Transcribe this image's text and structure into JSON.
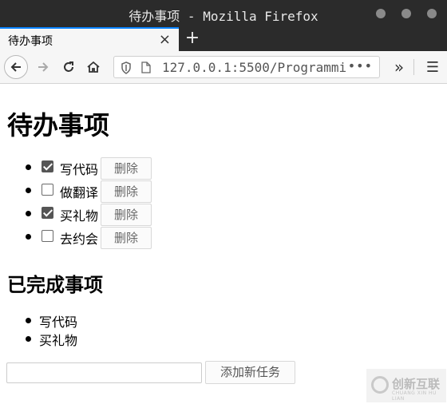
{
  "window": {
    "title": "待办事项 - Mozilla Firefox"
  },
  "tab": {
    "label": "待办事项",
    "close": "×",
    "new_tab": "+"
  },
  "nav": {
    "url": "127.0.0.1:5500/Programmi",
    "more": "•••",
    "overflow": "»",
    "menu": "☰"
  },
  "page": {
    "title": "待办事项",
    "todos": [
      {
        "text": "写代码",
        "checked": true,
        "delete_label": "删除"
      },
      {
        "text": "做翻译",
        "checked": false,
        "delete_label": "删除"
      },
      {
        "text": "买礼物",
        "checked": true,
        "delete_label": "删除"
      },
      {
        "text": "去约会",
        "checked": false,
        "delete_label": "删除"
      }
    ],
    "done_title": "已完成事项",
    "done": [
      "写代码",
      "买礼物"
    ],
    "new_task": {
      "value": "",
      "placeholder": "",
      "button_label": "添加新任务"
    }
  },
  "watermark": {
    "text": "创新互联",
    "sub": "CHUANG XIN HU LIAN"
  }
}
